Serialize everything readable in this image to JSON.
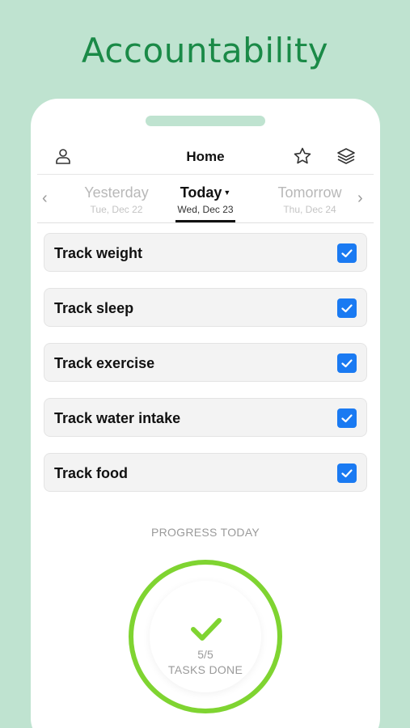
{
  "headline": "Accountability",
  "header": {
    "title": "Home",
    "icons": [
      "user-icon",
      "star-icon",
      "layers-icon"
    ]
  },
  "days": {
    "prev": {
      "label": "Yesterday",
      "date": "Tue, Dec 22"
    },
    "current": {
      "label": "Today",
      "date": "Wed, Dec 23"
    },
    "next": {
      "label": "Tomorrow",
      "date": "Thu, Dec 24"
    }
  },
  "tasks": [
    {
      "label": "Track weight",
      "checked": true
    },
    {
      "label": "Track sleep",
      "checked": true
    },
    {
      "label": "Track exercise",
      "checked": true
    },
    {
      "label": "Track water intake",
      "checked": true
    },
    {
      "label": "Track food",
      "checked": true
    }
  ],
  "progress": {
    "label": "PROGRESS TODAY",
    "count": "5/5",
    "caption": "TASKS DONE",
    "done": 5,
    "total": 5
  },
  "colors": {
    "background": "#bfe3d0",
    "headline": "#1a8a47",
    "checkbox": "#1a7af2",
    "ring": "#7fd431"
  }
}
